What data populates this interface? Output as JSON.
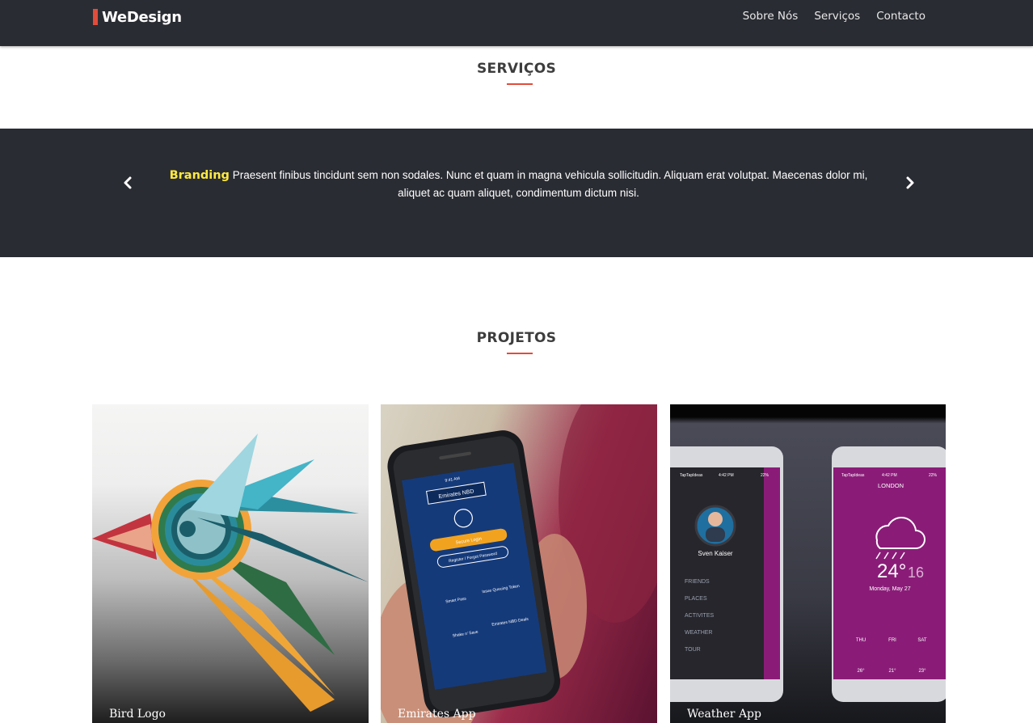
{
  "brand": {
    "name": "WeDesign",
    "accent": "#e24c3a"
  },
  "nav": {
    "items": [
      {
        "label": "Sobre Nós"
      },
      {
        "label": "Serviços"
      },
      {
        "label": "Contacto"
      }
    ]
  },
  "services": {
    "title": "SERVIÇOS",
    "carousel": {
      "prev_icon": "chevron-left-icon",
      "next_icon": "chevron-right-icon",
      "highlight": "Branding",
      "text": "Praesent finibus tincidunt sem non sodales. Nunc et quam in magna vehicula sollicitudin. Aliquam erat volutpat. Maecenas dolor mi, aliquet ac quam aliquet, condimentum dictum nisi.",
      "highlight_color": "#ffea3c",
      "background": "#2a2c33"
    }
  },
  "projects": {
    "title": "PROJETOS",
    "items": [
      {
        "caption": "Bird Logo",
        "image": "bird-logo-image"
      },
      {
        "caption": "Emirates App",
        "image": "emirates-app-image",
        "screen": {
          "status_time": "9:41 AM",
          "bank": "Emirates NBD",
          "login_button": "Secure Login",
          "register_button": "Register / Forgot Password",
          "tiles": [
            "Smart Pass",
            "Issue Queuing Token",
            "Shake n' Save",
            "Emirates NBD Deals"
          ]
        }
      },
      {
        "caption": "Weather App",
        "image": "weather-app-image",
        "left_screen": {
          "status": "TapTapIdeas",
          "time": "4:42 PM",
          "battery": "22%",
          "user": "Sven Kaiser",
          "menu": [
            "FRIENDS",
            "PLACES",
            "ACTIVITES",
            "WEATHER",
            "TOUR"
          ]
        },
        "right_screen": {
          "status": "TapTapIdeas",
          "time": "4:42 PM",
          "battery": "22%",
          "city": "LONDON",
          "temperature": "24°",
          "low": "16",
          "date": "Monday, May 27",
          "days": [
            "THU",
            "FRI",
            "SAT"
          ],
          "day_temps": [
            "26°",
            "21°",
            "23°"
          ]
        }
      }
    ]
  }
}
